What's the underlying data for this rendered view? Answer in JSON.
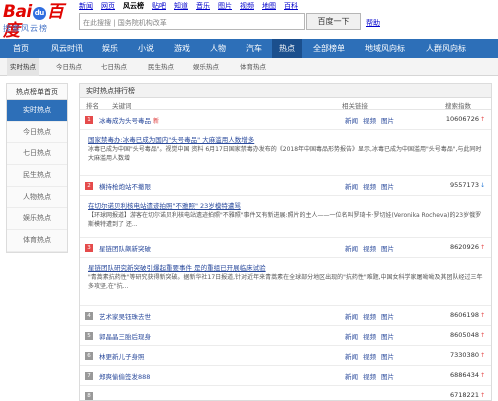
{
  "logo": {
    "part1": "Bai",
    "paw": "du",
    "part2": "百度",
    "subtitle": "搜索风云榜"
  },
  "topnav": [
    "新闻",
    "网页",
    "风云榜",
    "贴吧",
    "知道",
    "音乐",
    "图片",
    "视频",
    "地图",
    "百科"
  ],
  "search": {
    "placeholder": "在此搜搜 | 国务院机构改革",
    "button": "百度一下",
    "help": "帮助"
  },
  "mainnav": [
    "首页",
    "风云时讯",
    "娱乐",
    "小说",
    "游戏",
    "人物",
    "汽车",
    "热点",
    "全部榜单",
    "地域风向标",
    "人群风向标"
  ],
  "subnav": [
    "实时热点",
    "今日热点",
    "七日热点",
    "民生热点",
    "娱乐热点",
    "体育热点"
  ],
  "sidebar": {
    "head": "热点榜单首页",
    "items": [
      "实时热点",
      "今日热点",
      "七日热点",
      "民生热点",
      "人物热点",
      "娱乐热点",
      "体育热点"
    ]
  },
  "main": {
    "heading": "实时热点排行榜",
    "cols": {
      "rank": "排名",
      "keyword": "关键词",
      "related": "相关链接",
      "index": "搜索指数"
    },
    "link_labels": {
      "news": "新闻",
      "video": "视频",
      "image": "图片"
    },
    "rows": [
      {
        "rank": "1",
        "title": "冰毒成为头号毒品",
        "flag": "新",
        "index": "10606726",
        "trend": "up"
      },
      {
        "rank": "2",
        "title": "横持枪炮站不撤限",
        "flag": "",
        "index": "9557173",
        "trend": "down"
      },
      {
        "rank": "3",
        "title": "星链团队飙新突破",
        "flag": "",
        "index": "8620926",
        "trend": "up"
      },
      {
        "rank": "4",
        "title": "艺术家吴钰珠去世",
        "flag": "",
        "index": "8606198",
        "trend": "up"
      },
      {
        "rank": "5",
        "title": "郭晶晶三胎后现身",
        "flag": "",
        "index": "8605048",
        "trend": "up"
      },
      {
        "rank": "6",
        "title": "林更新儿子身照",
        "flag": "",
        "index": "7330380",
        "trend": "up"
      },
      {
        "rank": "7",
        "title": "郑爽偷偷签发888",
        "flag": "",
        "index": "6886434",
        "trend": "up"
      },
      {
        "rank": "8",
        "title": "",
        "flag": "",
        "index": "6718221",
        "trend": "up"
      }
    ],
    "details": [
      {
        "title": "国家禁毒办:冰毒已成为国内\"头号毒品\" 大麻滥用人数增多",
        "text": "冰毒已成为中国\"头号毒品\"。视觉中国 资料 6月17日国家禁毒办发布的《2018年中国毒品形势报告》显示,冰毒已成为中国滥用\"头号毒品\",与此同时大麻滥用人数增"
      },
      {
        "title": "在切尔诺贝利核电站遗迹拍照\"不雅照\" 23岁模特遭骂",
        "text": "【环球网报道】游客在切尔诺贝利核电站遗迹拍照\"不雅照\"事件又有新进展:照片的主人——一位名叫罗琦卡·罗切娃(Veronika Rocheva)的23岁俄罗斯模特遭到了 还..."
      },
      {
        "title": "星链团队研究新突破引爆起重要事件 是的重组已开展临床试验",
        "text": "\"青蒿素抗药性\"等研究获得新突破。据新华社17日报道,针对近年来青蒿素在全球部分地区出现的\"抗药性\"难题,中国女科学家屠呦呦及其团队经过三年多攻坚,在\"抗..."
      }
    ]
  }
}
